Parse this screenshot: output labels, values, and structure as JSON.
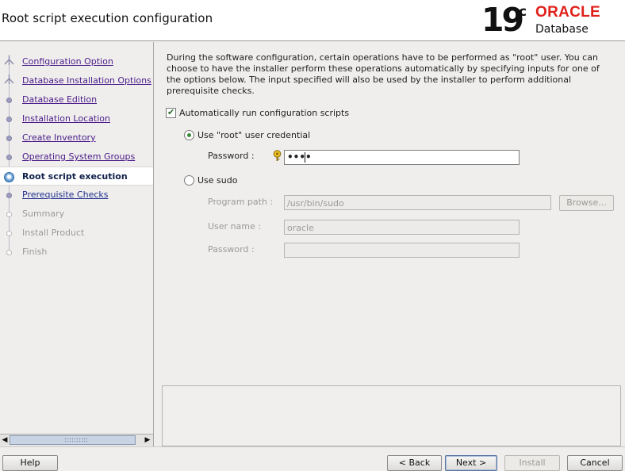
{
  "header": {
    "title": "Root script execution configuration",
    "logo_version": "19",
    "logo_version_suffix": "c",
    "logo_brand": "ORACLE",
    "logo_product": "Database",
    "brand_color": "#e0201b"
  },
  "nav": {
    "items": [
      {
        "label": "Configuration Option",
        "state": "visited"
      },
      {
        "label": "Database Installation Options",
        "state": "visited"
      },
      {
        "label": "Database Edition",
        "state": "visited"
      },
      {
        "label": "Installation Location",
        "state": "visited"
      },
      {
        "label": "Create Inventory",
        "state": "visited"
      },
      {
        "label": "Operating System Groups",
        "state": "visited"
      },
      {
        "label": "Root script execution",
        "state": "current"
      },
      {
        "label": "Prerequisite Checks",
        "state": "link"
      },
      {
        "label": "Summary",
        "state": "disabled"
      },
      {
        "label": "Install Product",
        "state": "disabled"
      },
      {
        "label": "Finish",
        "state": "disabled"
      }
    ]
  },
  "main": {
    "intro": "During the software configuration, certain operations have to be performed as \"root\" user. You can choose to have the installer perform these operations automatically by specifying inputs for one of the options below. The input specified will also be used by the installer to perform additional prerequisite checks.",
    "auto_run_label": "Automatically run configuration scripts",
    "auto_run_checked": true,
    "root_option_label": "Use \"root\" user credential",
    "root_selected": true,
    "password_label": "Password :",
    "password_value": "••••",
    "sudo_option_label": "Use sudo",
    "sudo_selected": false,
    "program_path_label": "Program path :",
    "program_path_value": "/usr/bin/sudo",
    "browse_label": "Browse...",
    "user_name_label": "User name :",
    "user_name_value": "oracle",
    "sudo_password_label": "Password :",
    "sudo_password_value": ""
  },
  "footer": {
    "help_label": "Help",
    "back_label": "< Back",
    "next_label": "Next >",
    "install_label": "Install",
    "cancel_label": "Cancel"
  }
}
